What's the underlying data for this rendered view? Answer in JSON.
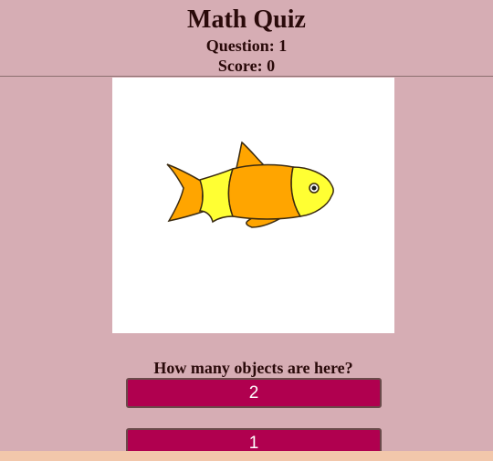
{
  "header": {
    "title": "Math Quiz",
    "question_label": "Question: 1",
    "score_label": "Score: 0"
  },
  "quiz": {
    "prompt": "How many objects are here?",
    "object_icon": "fish-icon",
    "answers": [
      "2",
      "1"
    ]
  },
  "colors": {
    "background": "#d6adb4",
    "button": "#b0004f",
    "fish_body": "#ffa500",
    "fish_accent": "#ffff33",
    "bottom_strip": "#f2c7ab"
  }
}
